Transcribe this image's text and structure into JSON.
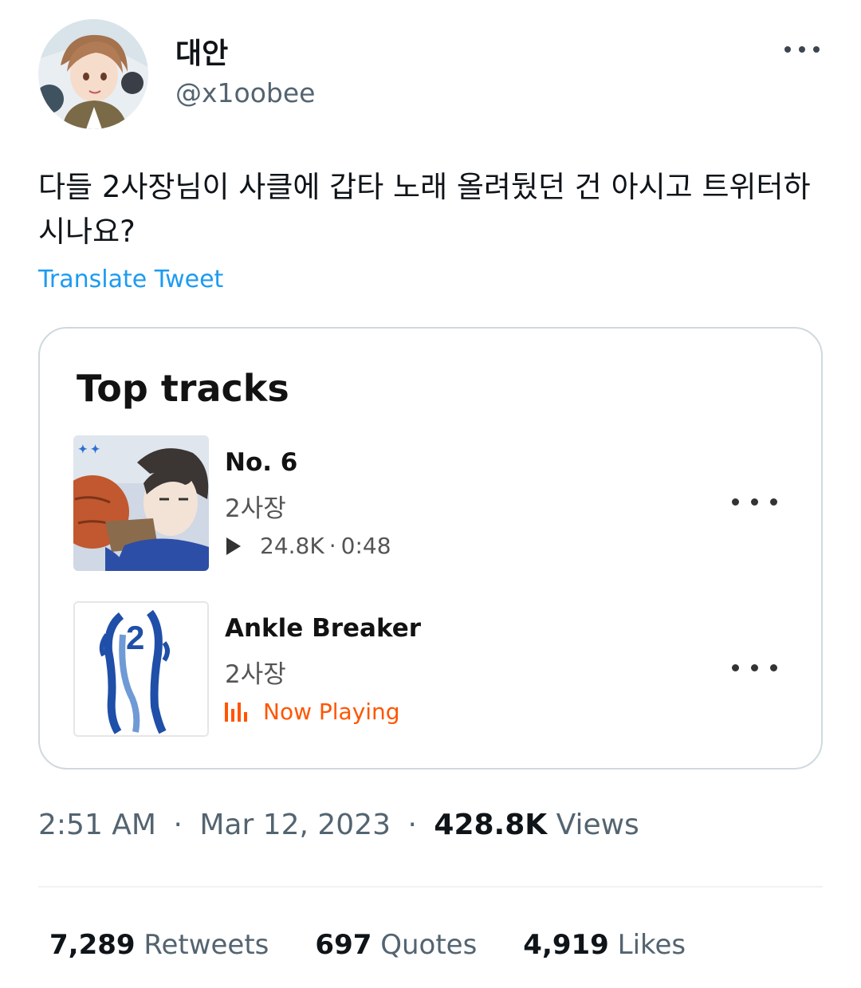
{
  "user": {
    "display_name": "대안",
    "handle": "@x1oobee",
    "avatar_icon": "profile-avatar-illustration"
  },
  "tweet": {
    "text": "다들 2사장님이 사클에 갑타 노래 올려뒀던 건 아시고 트위터하시나요?",
    "translate_label": "Translate Tweet"
  },
  "card": {
    "title": "Top tracks",
    "tracks": [
      {
        "title": "No. 6",
        "artist": "2사장",
        "plays": "24.8K",
        "separator": "·",
        "duration": "0:48",
        "play_icon": "play-icon"
      },
      {
        "title": "Ankle Breaker",
        "artist": "2사장",
        "status": "Now Playing",
        "status_icon": "equalizer-icon"
      }
    ]
  },
  "meta": {
    "time": "2:51 AM",
    "dot": "·",
    "date": "Mar 12, 2023",
    "views_count": "428.8K",
    "views_label": "Views"
  },
  "stats": {
    "retweets_count": "7,289",
    "retweets_label": "Retweets",
    "quotes_count": "697",
    "quotes_label": "Quotes",
    "likes_count": "4,919",
    "likes_label": "Likes"
  },
  "colors": {
    "link": "#1d9bf0",
    "accent": "#ff5500",
    "secondary_text": "#536471",
    "border": "#cfd9de"
  }
}
